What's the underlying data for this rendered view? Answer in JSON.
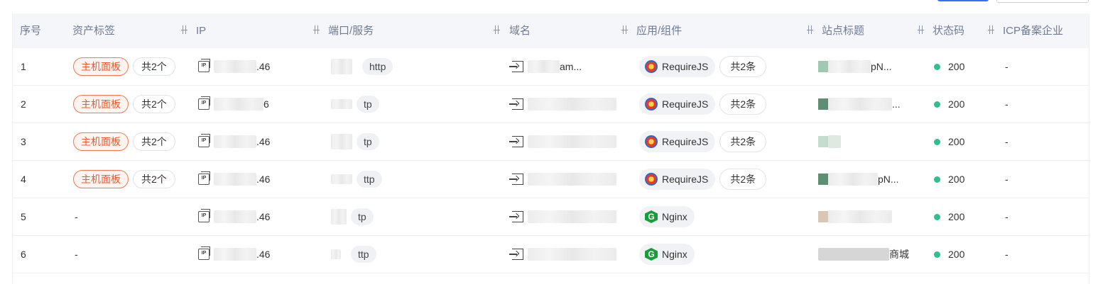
{
  "headers": {
    "index": "序号",
    "asset_tag": "资产标签",
    "ip": "IP",
    "port_service": "端口/服务",
    "domain": "域名",
    "app_component": "应用/组件",
    "site_title": "站点标题",
    "status_code": "状态码",
    "icp": "ICP备案企业"
  },
  "rows": [
    {
      "index": "1",
      "tag": "主机面板",
      "tag_count": "共2个",
      "ip": ".46",
      "service": "http",
      "domain": "am...",
      "component": "RequireJS",
      "component_icon": "requirejs-icon",
      "component_count": "共2条",
      "title": "pN...",
      "status": "200",
      "icp": "-"
    },
    {
      "index": "2",
      "tag": "主机面板",
      "tag_count": "共2个",
      "ip": "6",
      "service": "tp",
      "domain": "",
      "component": "RequireJS",
      "component_icon": "requirejs-icon",
      "component_count": "共2条",
      "title": "...",
      "status": "200",
      "icp": "-"
    },
    {
      "index": "3",
      "tag": "主机面板",
      "tag_count": "共2个",
      "ip": ".46",
      "service": "tp",
      "domain": "",
      "component": "RequireJS",
      "component_icon": "requirejs-icon",
      "component_count": "共2条",
      "title": "",
      "status": "200",
      "icp": "-"
    },
    {
      "index": "4",
      "tag": "主机面板",
      "tag_count": "共2个",
      "ip": ".46",
      "service": "ttp",
      "domain": "",
      "component": "RequireJS",
      "component_icon": "requirejs-icon",
      "component_count": "共2条",
      "title": "pN...",
      "status": "200",
      "icp": "-"
    },
    {
      "index": "5",
      "tag": "-",
      "tag_count": "",
      "ip": ".46",
      "service": "tp",
      "domain": "",
      "component": "Nginx",
      "component_icon": "nginx-icon",
      "component_count": "",
      "title": "",
      "status": "200",
      "icp": "-"
    },
    {
      "index": "6",
      "tag": "-",
      "tag_count": "",
      "ip": ".46",
      "service": "ttp",
      "domain": "",
      "component": "Nginx",
      "component_icon": "nginx-icon",
      "component_count": "",
      "title": "商城",
      "status": "200",
      "icp": "-"
    }
  ],
  "colors": {
    "accent": "#3a6cf4",
    "tag_orange": "#ec5a2e",
    "status_ok": "#2fbf8a",
    "header_bg": "#f5f6fa"
  }
}
